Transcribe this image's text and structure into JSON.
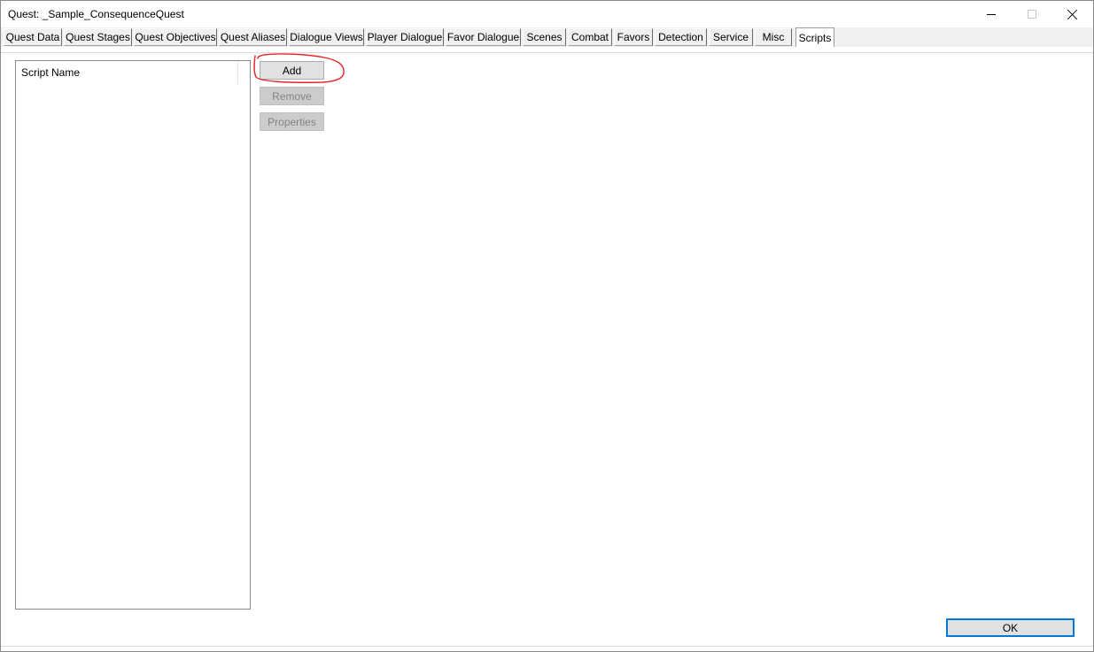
{
  "window": {
    "title": "Quest: _Sample_ConsequenceQuest"
  },
  "tabs": [
    {
      "label": "Quest Data"
    },
    {
      "label": "Quest Stages"
    },
    {
      "label": "Quest Objectives"
    },
    {
      "label": "Quest Aliases"
    },
    {
      "label": "Dialogue Views"
    },
    {
      "label": "Player Dialogue"
    },
    {
      "label": "Favor Dialogue"
    },
    {
      "label": "Scenes"
    },
    {
      "label": "Combat"
    },
    {
      "label": "Favors"
    },
    {
      "label": "Detection"
    },
    {
      "label": "Service"
    },
    {
      "label": "Misc"
    },
    {
      "label": "Scripts",
      "active": true
    }
  ],
  "scripts_list": {
    "column_header": "Script Name",
    "rows": []
  },
  "buttons": {
    "add": "Add",
    "remove": "Remove",
    "properties": "Properties",
    "ok": "OK"
  },
  "annotation_color": "#e8262a"
}
